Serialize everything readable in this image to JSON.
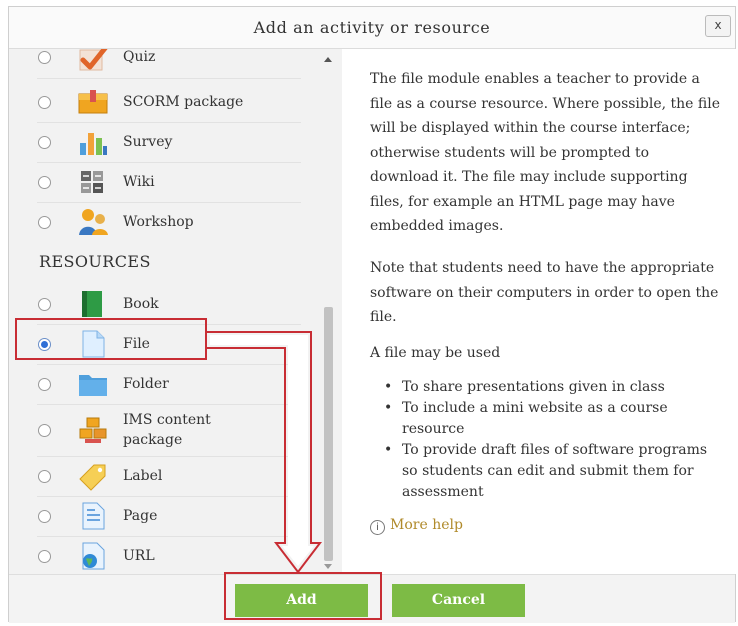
{
  "dialog": {
    "title": "Add an activity or resource",
    "close_label": "x"
  },
  "activities": [
    {
      "label": "Quiz",
      "icon": "quiz-checkmark-icon",
      "selected": false
    },
    {
      "label": "SCORM package",
      "icon": "scorm-package-icon",
      "selected": false
    },
    {
      "label": "Survey",
      "icon": "survey-chart-icon",
      "selected": false
    },
    {
      "label": "Wiki",
      "icon": "wiki-icon",
      "selected": false
    },
    {
      "label": "Workshop",
      "icon": "workshop-people-icon",
      "selected": false
    }
  ],
  "resources_heading": "RESOURCES",
  "resources": [
    {
      "label": "Book",
      "icon": "book-icon",
      "selected": false
    },
    {
      "label": "File",
      "icon": "file-icon",
      "selected": true
    },
    {
      "label": "Folder",
      "icon": "folder-icon",
      "selected": false
    },
    {
      "label_line1": "IMS content",
      "label_line2": "package",
      "icon": "ims-package-icon",
      "selected": false
    },
    {
      "label": "Label",
      "icon": "label-tag-icon",
      "selected": false
    },
    {
      "label": "Page",
      "icon": "page-icon",
      "selected": false
    },
    {
      "label": "URL",
      "icon": "url-globe-icon",
      "selected": false
    }
  ],
  "description": {
    "paragraph1": "The file module enables a teacher to provide a file as a course resource. Where possible, the file will be displayed within the course interface; otherwise students will be prompted to download it. The file may include supporting files, for example an HTML page may have embedded images.",
    "paragraph2": "Note that students need to have the appropriate software on their computers in order to open the file.",
    "paragraph3": "A file may be used",
    "bullets": [
      "To share presentations given in class",
      "To include a mini website as a course resource",
      "To provide draft files of software programs so students can edit and submit them for assessment"
    ],
    "more_help": "More help",
    "info_glyph": "i"
  },
  "footer": {
    "add_label": "Add",
    "cancel_label": "Cancel"
  },
  "colors": {
    "button_green": "#7dbb45",
    "highlight_red": "#c82d34",
    "help_link": "#b08a2a"
  }
}
